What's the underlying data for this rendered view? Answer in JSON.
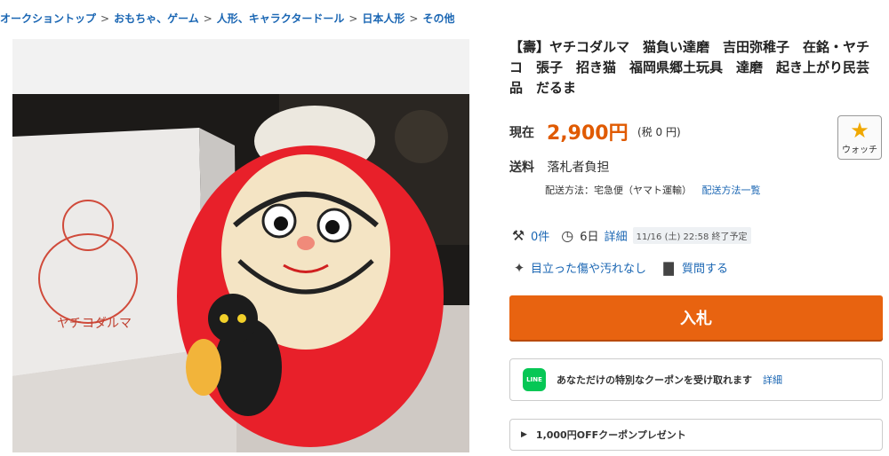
{
  "breadcrumb": [
    "オークショントップ",
    "おもちゃ、ゲーム",
    "人形、キャラクタードール",
    "日本人形",
    "その他"
  ],
  "breadcrumb_sep": ">",
  "image": {
    "box_text": "ヤチコダルマ"
  },
  "item": {
    "title": "【壽】ヤチコダルマ　猫負い達磨　吉田弥稚子　在銘・ヤチコ　張子　招き猫　福岡県郷土玩具　達磨　起き上がり民芸品　だるま"
  },
  "price": {
    "label": "現在",
    "value": "2,900円",
    "tax": "(税 0 円)"
  },
  "watch": {
    "label": "ウォッチ",
    "icon": "star-icon"
  },
  "shipping": {
    "label": "送料",
    "value": "落札者負担",
    "method": "配送方法：宅急便（ヤマト運輸）",
    "method_link": "配送方法一覧"
  },
  "bids": {
    "count": "0件",
    "time_left": "6日",
    "detail_link": "詳細",
    "end": "11/16 (土) 22:58 終了予定"
  },
  "condition": {
    "text": "目立った傷や汚れなし",
    "question": "質問する"
  },
  "bid_button": "入札",
  "coupon": {
    "icon_text": "LINE",
    "text": "あなただけの特別なクーポンを受け取れます",
    "detail": "詳細"
  },
  "present": {
    "text": "1,000円OFFクーポンプレゼント"
  },
  "colors": {
    "accent": "#e86310",
    "price": "#e05a00",
    "link": "#1a66b3",
    "line": "#06c755"
  }
}
